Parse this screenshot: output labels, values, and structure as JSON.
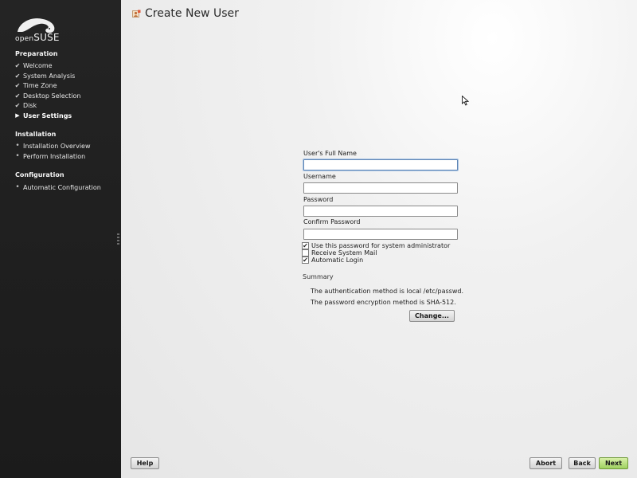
{
  "logo": {
    "text_open": "open",
    "text_suse": "SUSE"
  },
  "sidebar": {
    "sections": [
      {
        "title": "Preparation",
        "steps": [
          {
            "label": "Welcome",
            "state": "done"
          },
          {
            "label": "System Analysis",
            "state": "done"
          },
          {
            "label": "Time Zone",
            "state": "done"
          },
          {
            "label": "Desktop Selection",
            "state": "done"
          },
          {
            "label": "Disk",
            "state": "done"
          },
          {
            "label": "User Settings",
            "state": "current"
          }
        ]
      },
      {
        "title": "Installation",
        "steps": [
          {
            "label": "Installation Overview",
            "state": "pending"
          },
          {
            "label": "Perform Installation",
            "state": "pending"
          }
        ]
      },
      {
        "title": "Configuration",
        "steps": [
          {
            "label": "Automatic Configuration",
            "state": "pending"
          }
        ]
      }
    ]
  },
  "page": {
    "title": "Create New User"
  },
  "form": {
    "full_name": {
      "label": "User's Full Name",
      "value": ""
    },
    "username": {
      "label": "Username",
      "value": ""
    },
    "password": {
      "label": "Password",
      "value": ""
    },
    "confirm_password": {
      "label": "Confirm Password",
      "value": ""
    },
    "checkboxes": [
      {
        "label": "Use this password for system administrator",
        "checked": true
      },
      {
        "label": "Receive System Mail",
        "checked": false
      },
      {
        "label": "Automatic Login",
        "checked": true
      }
    ]
  },
  "summary": {
    "label": "Summary",
    "lines": [
      "The authentication method is local /etc/passwd.",
      "The password encryption method is SHA-512."
    ],
    "change_label": "Change..."
  },
  "buttons": {
    "help": "Help",
    "abort": "Abort",
    "back": "Back",
    "next": "Next"
  },
  "icons": {
    "check": "check-icon",
    "arrow": "current-step-arrow-icon",
    "bullet": "bullet-icon",
    "user_settings": "user-settings-icon"
  },
  "colors": {
    "sidebar_bg": "#1f1f1f",
    "next_button": "#9fd160",
    "field_focus": "#5f86b5"
  }
}
